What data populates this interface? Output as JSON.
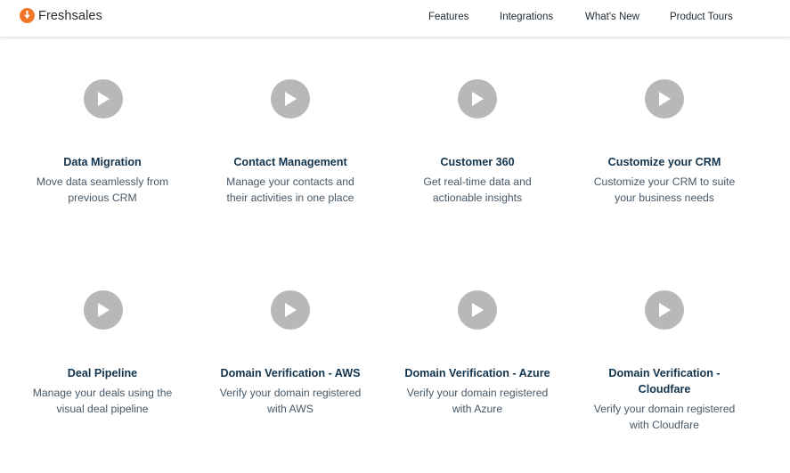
{
  "header": {
    "brand": "Freshsales",
    "nav": {
      "features": "Features",
      "integrations": "Integrations",
      "whats_new": "What's New",
      "product_tours": "Product Tours"
    }
  },
  "colors": {
    "brand_accent": "#f2762a",
    "play_button": "#b8b8b8",
    "title_text": "#12344d",
    "body_text": "#475867"
  },
  "tours": [
    {
      "title": "Data Migration",
      "description": "Move data seamlessly from previous CRM",
      "icon": "play-icon"
    },
    {
      "title": "Contact Management",
      "description": "Manage your contacts and their activities in one place",
      "icon": "play-icon"
    },
    {
      "title": "Customer 360",
      "description": "Get real-time data and actionable insights",
      "icon": "play-icon"
    },
    {
      "title": "Customize your CRM",
      "description": "Customize your CRM to suite your business needs",
      "icon": "play-icon"
    },
    {
      "title": "Deal Pipeline",
      "description": "Manage your deals using the visual deal pipeline",
      "icon": "play-icon"
    },
    {
      "title": "Domain Verification - AWS",
      "description": "Verify your domain registered with AWS",
      "icon": "play-icon"
    },
    {
      "title": "Domain Verification - Azure",
      "description": "Verify your domain registered with Azure",
      "icon": "play-icon"
    },
    {
      "title": "Domain Verification - Cloudfare",
      "description": "Verify your domain registered with Cloudfare",
      "icon": "play-icon"
    }
  ]
}
